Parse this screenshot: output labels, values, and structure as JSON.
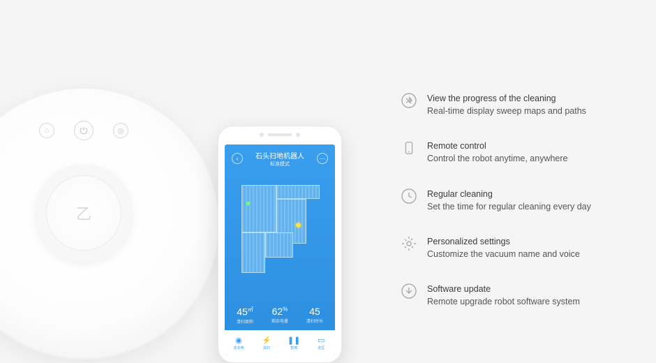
{
  "robot": {
    "logo": "乙"
  },
  "phone": {
    "app_title": "石头扫地机器人",
    "app_subtitle": "标准模式",
    "stats": [
      {
        "value": "45",
        "unit": "㎡",
        "label": "清扫面积"
      },
      {
        "value": "62",
        "unit": "%",
        "label": "剩余电量"
      },
      {
        "value": "45",
        "unit": "",
        "label": "清扫时长"
      }
    ],
    "nav": [
      {
        "label": "去充电"
      },
      {
        "label": "清扫"
      },
      {
        "label": "暂停"
      },
      {
        "label": "定区"
      }
    ]
  },
  "features": [
    {
      "icon": "progress",
      "title": "View the progress of the cleaning",
      "subtitle": "Real-time display sweep maps and paths"
    },
    {
      "icon": "remote",
      "title": "Remote control",
      "subtitle": "Control  the robot anytime, anywhere"
    },
    {
      "icon": "clock",
      "title": "Regular cleaning",
      "subtitle": "Set the time for regular cleaning every day"
    },
    {
      "icon": "gear",
      "title": "Personalized settings",
      "subtitle": "Customize the vacuum name and voice"
    },
    {
      "icon": "download",
      "title": "Software update",
      "subtitle": "Remote upgrade robot software system"
    }
  ]
}
